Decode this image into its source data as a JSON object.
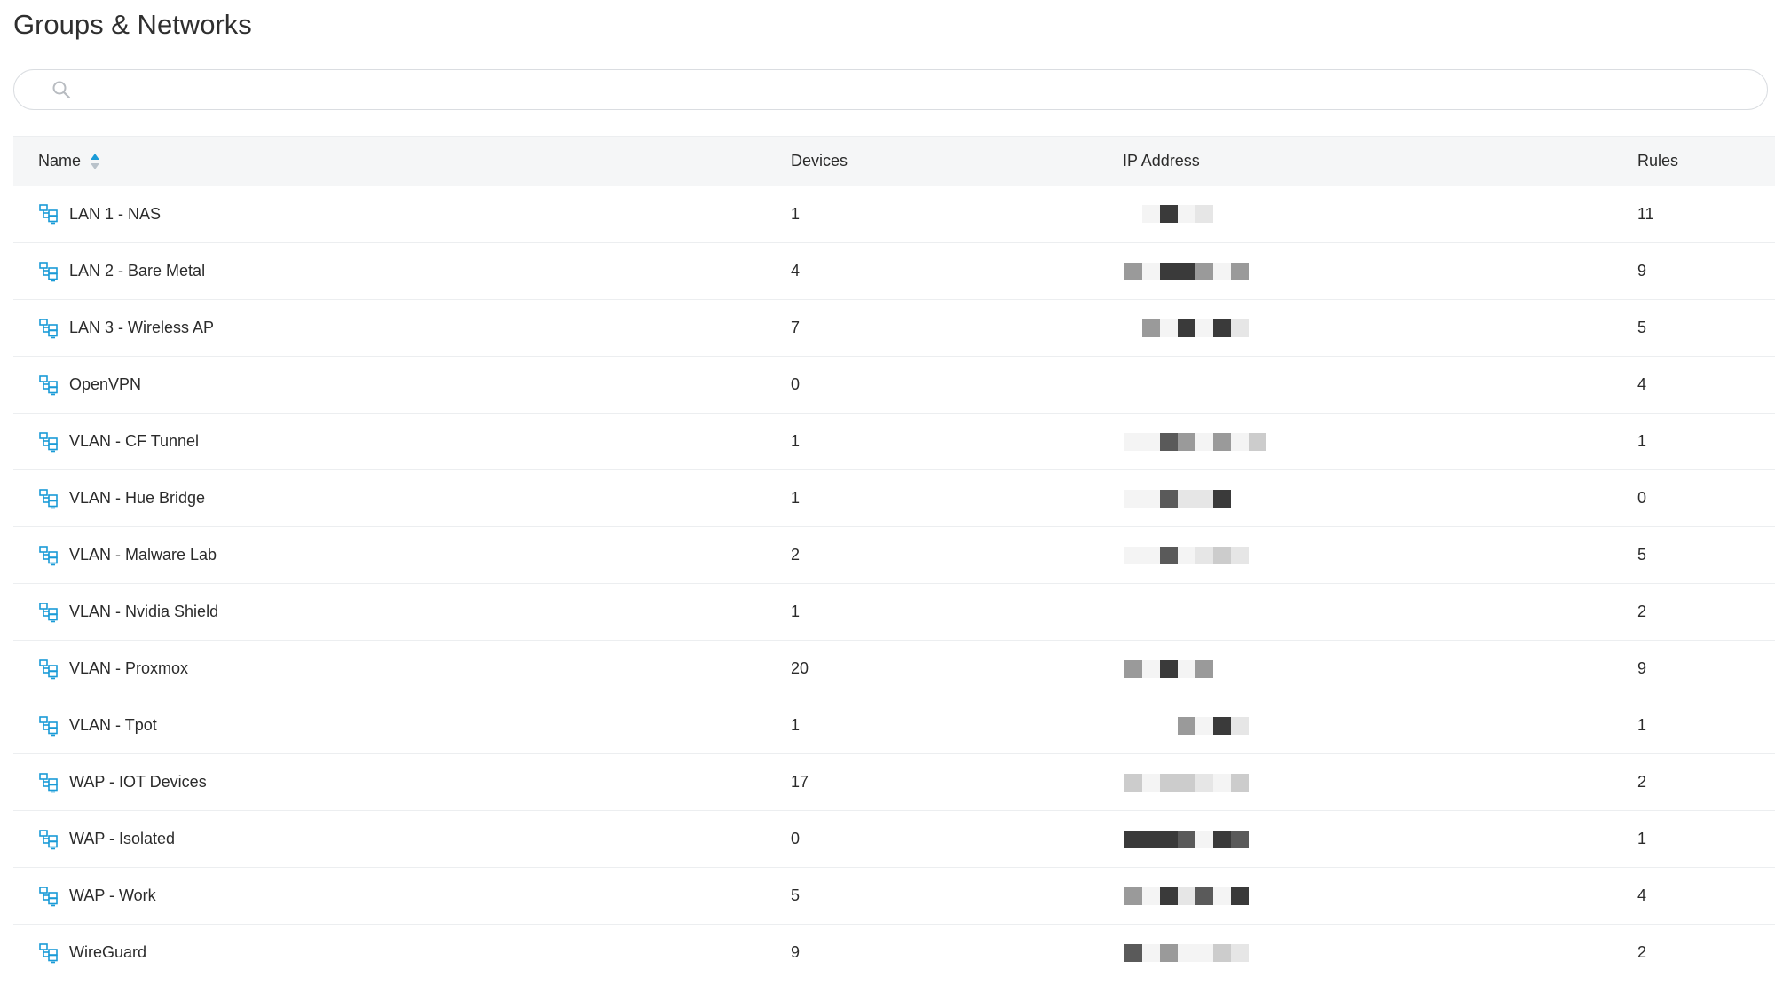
{
  "page": {
    "title": "Groups & Networks"
  },
  "search": {
    "placeholder": "",
    "value": ""
  },
  "table": {
    "columns": {
      "name": "Name",
      "devices": "Devices",
      "ip": "IP Address",
      "rules": "Rules"
    },
    "sort": {
      "column": "Name",
      "direction": "ascending"
    },
    "rows": [
      {
        "name": "LAN 1 - NAS",
        "devices": "1",
        "rules": "11"
      },
      {
        "name": "LAN 2 - Bare Metal",
        "devices": "4",
        "rules": "9"
      },
      {
        "name": "LAN 3 - Wireless AP",
        "devices": "7",
        "rules": "5"
      },
      {
        "name": "OpenVPN",
        "devices": "0",
        "rules": "4"
      },
      {
        "name": "VLAN - CF Tunnel",
        "devices": "1",
        "rules": "1"
      },
      {
        "name": "VLAN - Hue Bridge",
        "devices": "1",
        "rules": "0"
      },
      {
        "name": "VLAN - Malware Lab",
        "devices": "2",
        "rules": "5"
      },
      {
        "name": "VLAN - Nvidia Shield",
        "devices": "1",
        "rules": "2"
      },
      {
        "name": "VLAN - Proxmox",
        "devices": "20",
        "rules": "9"
      },
      {
        "name": "VLAN - Tpot",
        "devices": "1",
        "rules": "1"
      },
      {
        "name": "WAP - IOT Devices",
        "devices": "17",
        "rules": "2"
      },
      {
        "name": "WAP - Isolated",
        "devices": "0",
        "rules": "1"
      },
      {
        "name": "WAP - Work",
        "devices": "5",
        "rules": "4"
      },
      {
        "name": "WireGuard",
        "devices": "9",
        "rules": "2"
      }
    ]
  },
  "icons": {
    "search": "search-icon",
    "sort": "sort-ascending-icon",
    "row": "network-icon"
  },
  "colors": {
    "accent": "#1a9bd7",
    "header_bg": "#f5f6f7",
    "border": "#eceef0",
    "text": "#2b2b2b"
  }
}
